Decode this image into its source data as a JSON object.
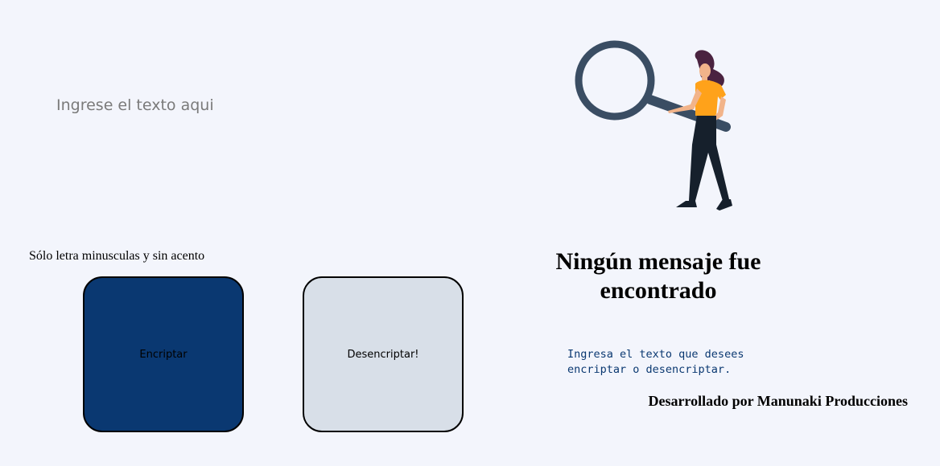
{
  "input": {
    "placeholder": "Ingrese el texto aqui",
    "value": ""
  },
  "hint": "Sólo letra minusculas y sin acento",
  "buttons": {
    "encrypt_label": "Encriptar",
    "decrypt_label": "Desencriptar!"
  },
  "colors": {
    "background": "#f3f5fc",
    "encrypt_button": "#0a3871",
    "decrypt_button": "#d8dfe8",
    "message_text": "#0a3871"
  },
  "output": {
    "title": "Ningún mensaje fue encontrado",
    "body": "Ingresa el texto que desees encriptar o desencriptar."
  },
  "footer": {
    "credits": "Desarrollado por Manunaki Producciones"
  },
  "illustration": {
    "icon": "woman-with-magnifier-illustration"
  }
}
